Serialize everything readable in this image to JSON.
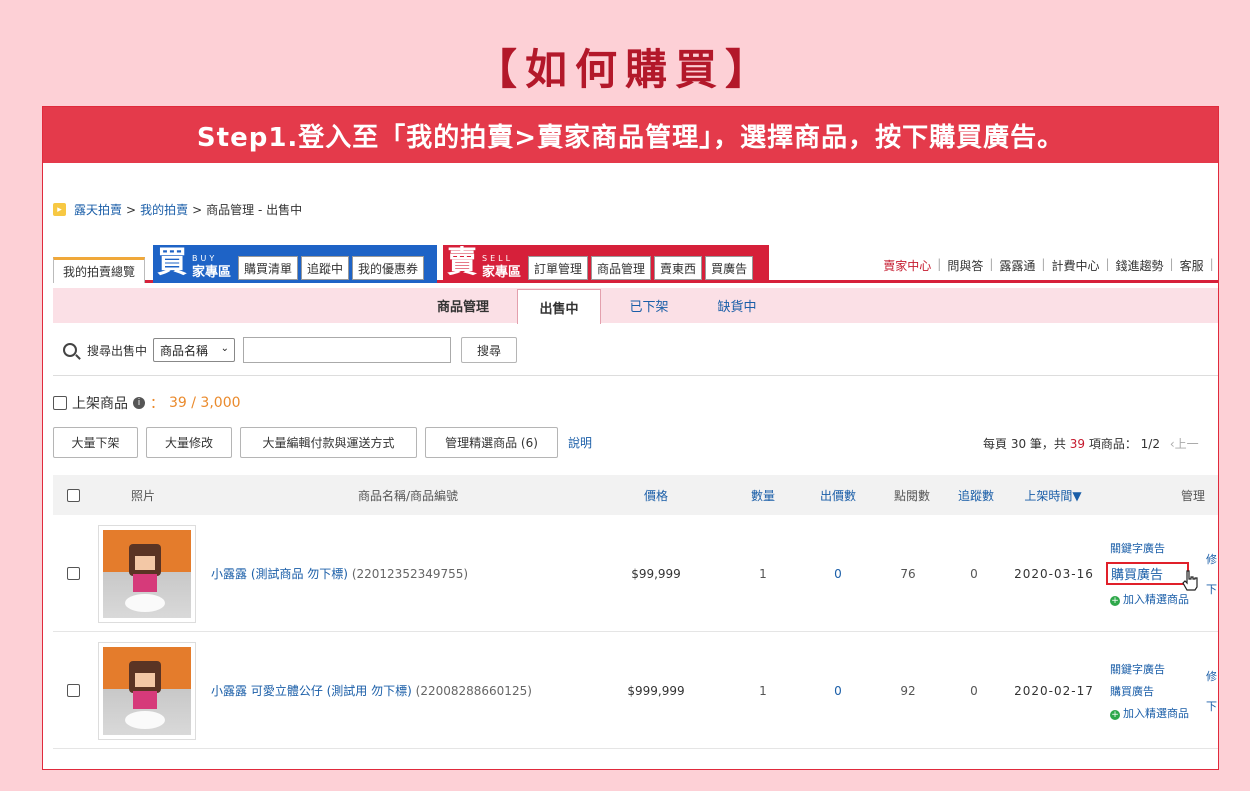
{
  "page_title": "【如何購買】",
  "banner": "Step1.登入至「我的拍賣>賣家商品管理」，選擇商品，按下購買廣告。",
  "breadcrumb": {
    "items": [
      "露天拍賣",
      "我的拍賣",
      "商品管理 - 出售中"
    ],
    "separator": ">"
  },
  "nav": {
    "home_tab": "我的拍賣總覽",
    "buy_zone": {
      "char": "買",
      "en": "BUY",
      "label": "家專區",
      "tabs": [
        "購買清單",
        "追蹤中",
        "我的優惠券"
      ]
    },
    "sell_zone": {
      "char": "賣",
      "en": "SELL",
      "label": "家專區",
      "tabs": [
        "訂單管理",
        "商品管理",
        "賣東西",
        "買廣告"
      ]
    },
    "right_links": [
      "賣家中心",
      "問與答",
      "露露通",
      "計費中心",
      "錢進趨勢",
      "客服",
      "l"
    ]
  },
  "subnav": {
    "title": "商品管理",
    "tabs": [
      "出售中",
      "已下架",
      "缺貨中"
    ]
  },
  "search": {
    "label": "搜尋出售中",
    "select_value": "商品名稱",
    "button": "搜尋"
  },
  "listing_count": {
    "label": "上架商品",
    "colon": "：",
    "value": "39 / 3,000"
  },
  "actions": [
    "大量下架",
    "大量修改",
    "大量編輯付款與運送方式",
    "管理精選商品 (6)"
  ],
  "help_link": "說明",
  "paging": {
    "prefix": "每頁 30 筆，共",
    "total": "39",
    "suffix": "項商品： 1/2",
    "prev": "‹上一"
  },
  "table": {
    "headers": [
      "照片",
      "商品名稱/商品編號",
      "價格",
      "數量",
      "出價數",
      "點閱數",
      "追蹤數",
      "上架時間▼",
      "管理"
    ],
    "rows": [
      {
        "name": "小露露 (測試商品 勿下標)",
        "id": "(22012352349755)",
        "price": "$99,999",
        "qty": "1",
        "bids": "0",
        "views": "76",
        "tracks": "0",
        "date": "2020-03-16",
        "manage": [
          "關鍵字廣告",
          "購買廣告",
          "加入精選商品"
        ],
        "manage2": [
          "修",
          "下"
        ]
      },
      {
        "name": "小露露 可愛立體公仔 (測試用 勿下標)",
        "id": "(22008288660125)",
        "price": "$999,999",
        "qty": "1",
        "bids": "0",
        "views": "92",
        "tracks": "0",
        "date": "2020-02-17",
        "manage": [
          "關鍵字廣告",
          "購買廣告",
          "加入精選商品"
        ],
        "manage2": [
          "修",
          "下"
        ]
      }
    ]
  },
  "colors": {
    "brand_red": "#e43a4b",
    "buy_blue": "#1e63c6",
    "link_blue": "#1a5ea8",
    "count_orange": "#ea8a2c"
  }
}
